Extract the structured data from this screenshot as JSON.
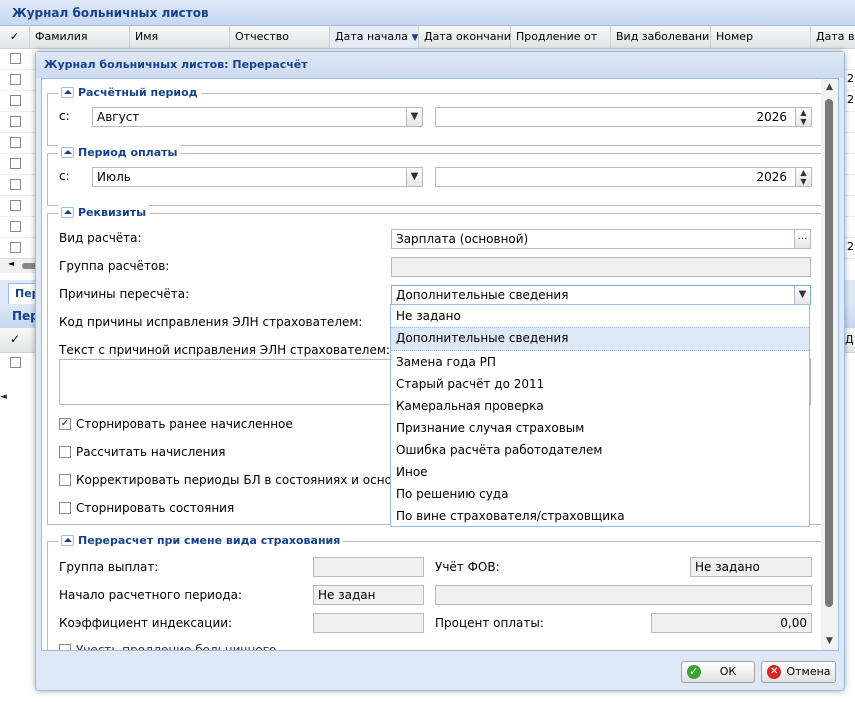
{
  "background": {
    "title": "Журнал больничных листов",
    "columns": [
      "Фамилия",
      "Имя",
      "Отчество",
      "Дата начала",
      "Дата окончания",
      "Продление от",
      "Вид заболевания",
      "Номер",
      "Дата вы"
    ],
    "sort_icon": "sort-desc-icon",
    "row_right_values": [
      "2",
      "2",
      "2"
    ],
    "tab_label": "Пер",
    "subpanel_title": "Пер",
    "subheader_right": "Д"
  },
  "dialog": {
    "title": "Журнал больничных листов: Перерасчёт",
    "calc_period": {
      "legend": "Расчётный период",
      "from_label": "с:",
      "month": "Август",
      "year": "2026"
    },
    "pay_period": {
      "legend": "Период оплаты",
      "from_label": "с:",
      "month": "Июль",
      "year": "2026"
    },
    "requisites": {
      "legend": "Реквизиты",
      "calc_type_label": "Вид расчёта:",
      "calc_type_value": "Зарплата (основной)",
      "calc_group_label": "Группа расчётов:",
      "reasons_label": "Причины пересчёта:",
      "reasons_value": "Дополнительные сведения",
      "eln_code_label": "Код причины исправления ЭЛН страхователем:",
      "eln_text_label": "Текст с причиной исправления ЭЛН страхователем:",
      "checkboxes": [
        {
          "label": "Сторнировать ранее начисленное",
          "checked": true
        },
        {
          "label": "Рассчитать начисления",
          "checked": false
        },
        {
          "label": "Корректировать периоды БЛ в состояниях и основаниях",
          "checked": false
        },
        {
          "label": "Сторнировать состояния",
          "checked": false
        }
      ],
      "dropdown_options": [
        "Не задано",
        "Дополнительные сведения",
        "Замена года РП",
        "Старый расчёт до 2011",
        "Камеральная проверка",
        "Признание случая страховым",
        "Ошибка расчёта работодателем",
        "Иное",
        "По решению суда",
        "По вине страхователя/страховщика"
      ],
      "dropdown_selected_index": 1
    },
    "insurance_change": {
      "legend": "Перерасчет при смене вида страхования",
      "pay_group_label": "Группа выплат:",
      "fov_label": "Учёт ФОВ:",
      "fov_value": "Не задано",
      "period_start_label": "Начало расчетного периода:",
      "period_start_value": "Не задан",
      "index_coef_label": "Коэффициент индексации:",
      "pay_percent_label": "Процент оплаты:",
      "pay_percent_value": "0,00",
      "extension_label": "Учесть продление больничного"
    },
    "buttons": {
      "ok": "ОК",
      "cancel": "Отмена"
    }
  }
}
